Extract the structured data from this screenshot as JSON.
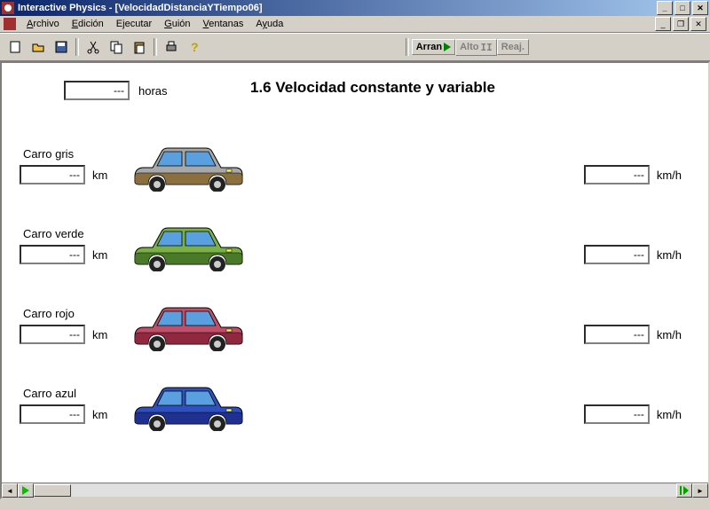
{
  "title": "Interactive Physics - [VelocidadDistanciaYTiempo06]",
  "menu": {
    "archivo": "Archivo",
    "edicion": "Edición",
    "ejecutar": "Ejecutar",
    "guion": "Guión",
    "ventanas": "Ventanas",
    "ayuda": "Ayuda"
  },
  "sim": {
    "run": "Arran",
    "stop": "Alto",
    "reset": "Reaj."
  },
  "heading": "1.6 Velocidad constante y variable",
  "time": {
    "value": "---",
    "unit": "horas"
  },
  "cars": [
    {
      "label": "Carro gris",
      "km": "---",
      "km_unit": "km",
      "speed": "---",
      "speed_unit": "km/h",
      "body": "#a8a8a8",
      "lower": "#8b6f3e",
      "windows": "#5aa0e0"
    },
    {
      "label": "Carro verde",
      "km": "---",
      "km_unit": "km",
      "speed": "---",
      "speed_unit": "km/h",
      "body": "#7ab048",
      "lower": "#4a7a28",
      "windows": "#5aa0e0"
    },
    {
      "label": "Carro rojo",
      "km": "---",
      "km_unit": "km",
      "speed": "---",
      "speed_unit": "km/h",
      "body": "#c0506a",
      "lower": "#902840",
      "windows": "#5aa0e0"
    },
    {
      "label": "Carro azul",
      "km": "---",
      "km_unit": "km",
      "speed": "---",
      "speed_unit": "km/h",
      "body": "#3050c0",
      "lower": "#203090",
      "windows": "#5aa0e0"
    }
  ]
}
